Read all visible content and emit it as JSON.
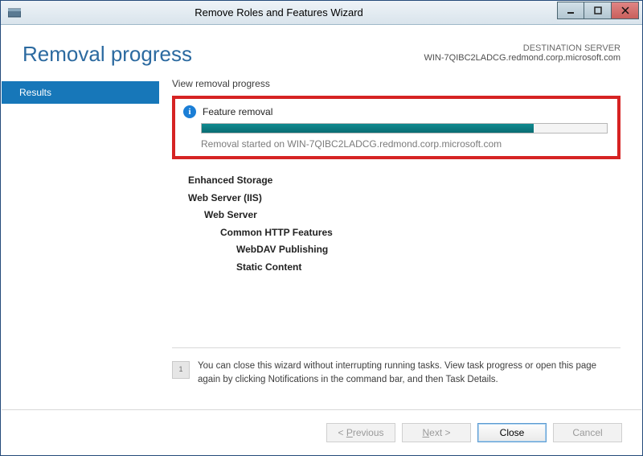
{
  "window": {
    "title": "Remove Roles and Features Wizard"
  },
  "header": {
    "title": "Removal progress",
    "server_label": "DESTINATION SERVER",
    "server_name": "WIN-7QIBC2LADCG.redmond.corp.microsoft.com"
  },
  "sidebar": {
    "results": "Results"
  },
  "main": {
    "section_label": "View removal progress",
    "feature_removal_label": "Feature removal",
    "progress_percent": 82,
    "status_text": "Removal started on WIN-7QIBC2LADCG.redmond.corp.microsoft.com",
    "tree": {
      "enhanced_storage": "Enhanced Storage",
      "web_server_iis": "Web Server (IIS)",
      "web_server": "Web Server",
      "common_http": "Common HTTP Features",
      "webdav": "WebDAV Publishing",
      "static_content": "Static Content"
    },
    "hint_icon": "1",
    "hint_text": "You can close this wizard without interrupting running tasks. View task progress or open this page again by clicking Notifications in the command bar, and then Task Details."
  },
  "footer": {
    "previous": "< Previous",
    "next": "Next >",
    "close": "Close",
    "cancel": "Cancel"
  }
}
